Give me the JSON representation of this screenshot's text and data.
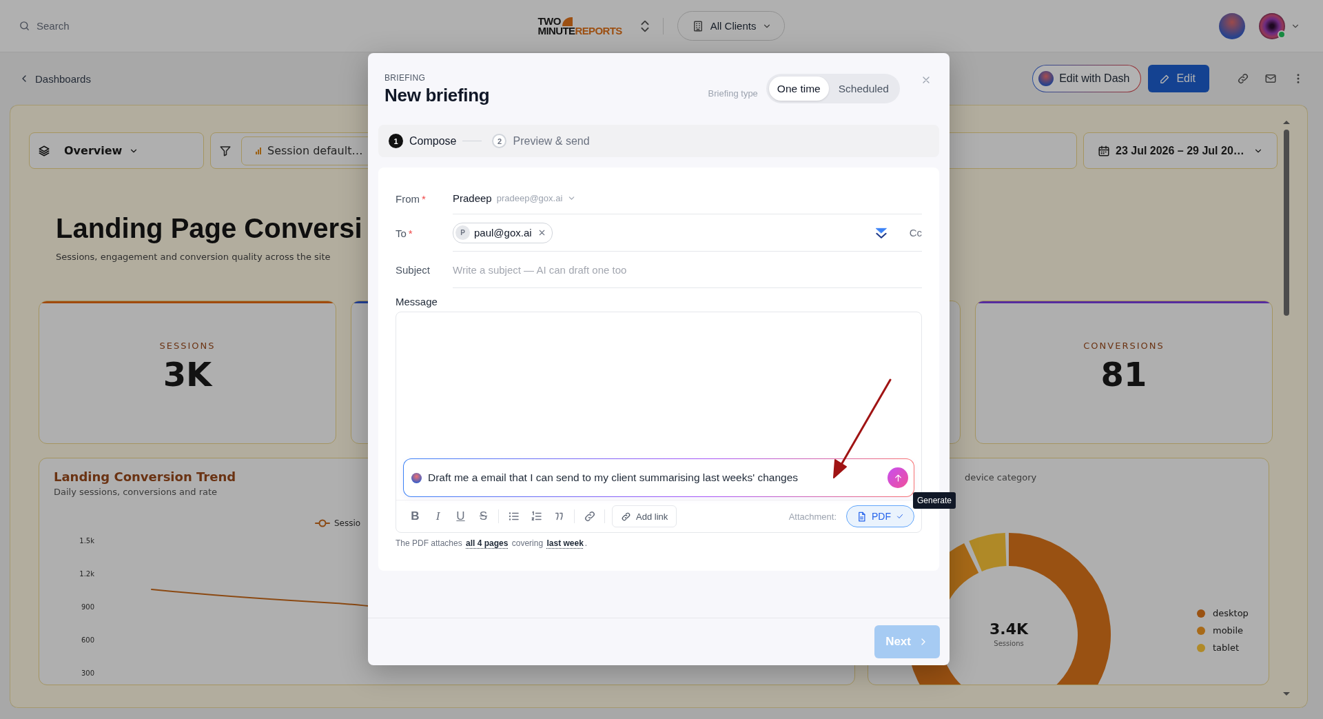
{
  "top_bar": {
    "search": {
      "placeholder": "Search"
    },
    "logo": {
      "top": "TWO",
      "bottom_left": "MINUTE",
      "bottom_right": "REPORTS"
    },
    "client_switch": "All Clients",
    "avatars": [
      {
        "online": false
      },
      {
        "online": true
      }
    ]
  },
  "nav_bar": {
    "back_link": "Dashboards",
    "actions": [
      {
        "kind": "dash",
        "label": "Edit with Dash"
      },
      {
        "kind": "primary",
        "label": "Edit"
      }
    ]
  },
  "dashboard": {
    "view_select": "Overview",
    "filter_chip": "Session default…",
    "date_range": "23 Jul 2026 – 29 Jul 20…",
    "title": "Landing Page Conversi",
    "subtitle": "Sessions, engagement and conversion quality across the site",
    "kpis": [
      {
        "kind": "metric",
        "label": "SESSIONS",
        "value": "3K",
        "color": "#a04a0d"
      },
      {
        "kind": "metric",
        "color": "#213f96"
      },
      {
        "kind": "metric"
      },
      {
        "kind": "metric",
        "label": "CONVERSIONS",
        "value": "81",
        "color": "#562c9f"
      }
    ],
    "trend_chart": {
      "title": "Landing Conversion Trend",
      "subtitle": "Daily sessions, conversions and rate",
      "legend": "Sessio",
      "y_labels": [
        "1.5k",
        "1.2k",
        "900",
        "600",
        "300"
      ]
    },
    "device_chart": {
      "subtitle": "device category",
      "center_value": "3.4K",
      "center_label": "Sessions",
      "legend": [
        {
          "label": "desktop",
          "color": "#9a5212"
        },
        {
          "label": "mobile",
          "color": "#a86a18"
        },
        {
          "label": "tablet",
          "color": "#b08a28"
        }
      ]
    }
  },
  "modal": {
    "eyebrow": "BRIEFING",
    "title": "New briefing",
    "type_label": "Briefing type",
    "types": [
      {
        "label": "One time",
        "selected": true
      },
      {
        "label": "Scheduled",
        "selected": false
      }
    ],
    "steps": [
      {
        "number": "1",
        "label": "Compose",
        "selected": true
      },
      {
        "number": "2",
        "label": "Preview & send",
        "selected": false
      }
    ],
    "form": {
      "from_label": "From",
      "from_required": "*",
      "from_name": "Pradeep",
      "from_email": "pradeep@gox.ai",
      "to_label": "To",
      "to_required": "*",
      "recipients": [
        {
          "initial": "P",
          "email": "paul@gox.ai"
        }
      ],
      "cc": "Cc",
      "subject_label": "Subject",
      "subject_placeholder": "Write a subject — AI can draft one too",
      "message_label": "Message",
      "prompt": "Draft me a email that I can send to my client summarising last weeks' changes",
      "toolbar": [
        {
          "kind": "bold",
          "label": "B"
        },
        {
          "kind": "italic",
          "label": "I"
        },
        {
          "kind": "underline",
          "label": "U"
        },
        {
          "kind": "strike",
          "label": "S"
        },
        {
          "kind": "bullets"
        },
        {
          "kind": "numbers"
        },
        {
          "kind": "quote"
        },
        {
          "kind": "link"
        }
      ],
      "add_link": "Add link",
      "attachment_label": "Attachment:",
      "attachment": {
        "label": "PDF",
        "checked": true
      },
      "hint": {
        "before": "The PDF attaches",
        "pages_link": "all 4 pages",
        "middle": "covering",
        "period_link": "last week",
        "after": "."
      }
    },
    "tooltip": "Generate",
    "next": {
      "label": "Next",
      "disabled": true
    }
  }
}
